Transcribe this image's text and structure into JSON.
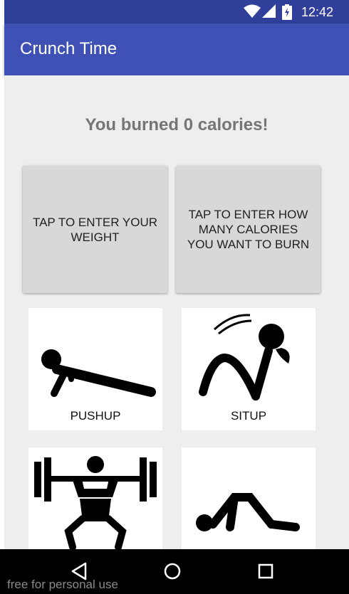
{
  "status_bar": {
    "time": "12:42",
    "icons": [
      "wifi-icon",
      "signal-icon",
      "battery-icon"
    ]
  },
  "app_bar": {
    "title": "Crunch Time"
  },
  "main": {
    "burned_text": "You burned 0 calories!",
    "weight_button": "TAP TO ENTER YOUR WEIGHT",
    "calories_button": "TAP TO ENTER HOW MANY CALORIES YOU WANT TO BURN",
    "exercises": [
      {
        "label": "PUSHUP",
        "icon": "pushup-icon"
      },
      {
        "label": "SITUP",
        "icon": "situp-icon"
      },
      {
        "label": "",
        "icon": "squat-icon"
      },
      {
        "label": "",
        "icon": "bridge-icon"
      }
    ]
  },
  "nav_bar": {
    "buttons": [
      "back-icon",
      "home-icon",
      "recents-icon"
    ]
  },
  "watermark": "free for personal use",
  "colors": {
    "primary": "#3f51b5",
    "primary_dark": "#30409a",
    "background": "#eeeeee",
    "button": "#d7d8d8",
    "text_grey": "#757575"
  }
}
